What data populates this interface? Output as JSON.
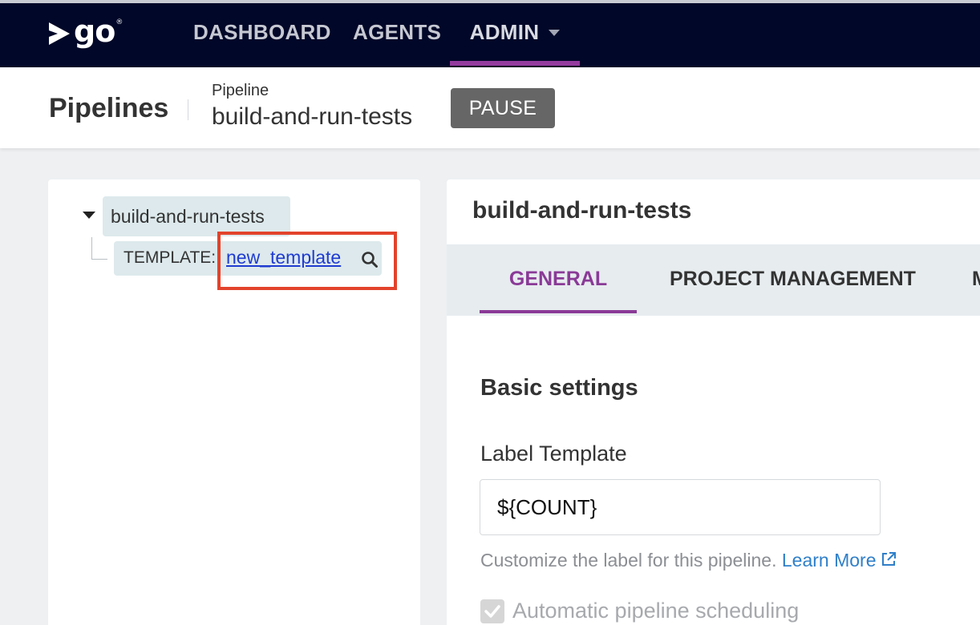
{
  "nav": {
    "logo_text": "go",
    "logo_mark": "®",
    "items": [
      {
        "label": "DASHBOARD"
      },
      {
        "label": "AGENTS"
      },
      {
        "label": "ADMIN"
      }
    ],
    "active": "ADMIN",
    "active_color": "#943a9e"
  },
  "header": {
    "title": "Pipelines",
    "pipeline_label": "Pipeline",
    "pipeline_name": "build-and-run-tests",
    "pause_label": "PAUSE"
  },
  "tree": {
    "root_label": "build-and-run-tests",
    "template_prefix": "TEMPLATE:",
    "template_name": "new_template"
  },
  "content": {
    "title": "build-and-run-tests",
    "tabs": [
      {
        "label": "GENERAL"
      },
      {
        "label": "PROJECT MANAGEMENT"
      },
      {
        "label": "M"
      }
    ],
    "active_tab": "GENERAL",
    "section_title": "Basic settings",
    "label_template": {
      "label": "Label Template",
      "value": "${COUNT}"
    },
    "help_text": "Customize the label for this pipeline.",
    "learn_more": "Learn More",
    "auto_schedule_label": "Automatic pipeline scheduling",
    "auto_schedule_checked": true
  },
  "colors": {
    "nav_bg": "#000728",
    "accent": "#943a9e",
    "link": "#1f3bd1",
    "highlight": "#e2432b",
    "pause_bg": "#666666"
  }
}
